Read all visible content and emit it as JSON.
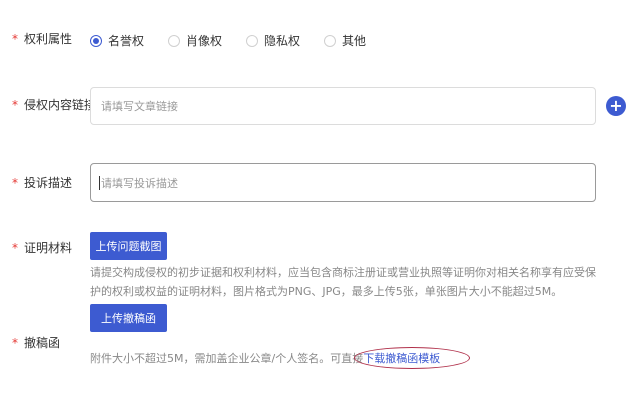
{
  "rights": {
    "label": "权利属性",
    "options": [
      "名誉权",
      "肖像权",
      "隐私权",
      "其他"
    ],
    "selected_index": 0
  },
  "link_field": {
    "label": "侵权内容链接",
    "placeholder": "请填写文章链接",
    "add_icon": "plus-circle-icon"
  },
  "description_field": {
    "label": "投诉描述",
    "placeholder": "请填写投诉描述"
  },
  "evidence": {
    "label": "证明材料",
    "button_label": "上传问题截图",
    "help_line1": "请提交构成侵权的初步证据和权利材料，应当包含商标注册证或营业执照等证明你对相关名称享有应受保",
    "help_line2": "护的权利或权益的证明材料，图片格式为PNG、JPG，最多上传5张，单张图片大小不能超过5M。"
  },
  "withdrawal": {
    "label": "撤稿函",
    "button_label": "上传撤稿函",
    "help_prefix": "附件大小不超过5M，需加盖企业公章/个人签名。可直接",
    "help_link": "下载撤稿函模板"
  },
  "required_mark": "*",
  "colors": {
    "primary": "#3d5bd1",
    "required": "#e53935",
    "annotation": "#b0304a"
  }
}
